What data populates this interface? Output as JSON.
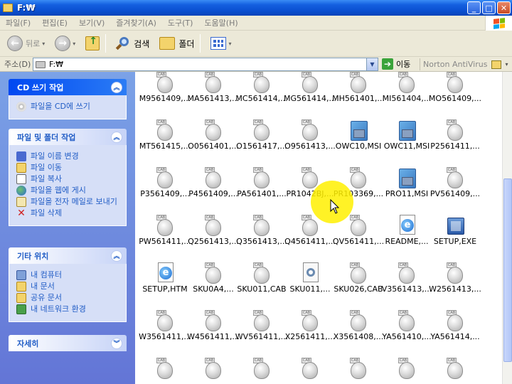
{
  "window": {
    "title": "F:₩",
    "min_glyph": "_",
    "max_glyph": "□",
    "close_glyph": "✕"
  },
  "menu": [
    "파일(F)",
    "편집(E)",
    "보기(V)",
    "즐겨찾기(A)",
    "도구(T)",
    "도움말(H)"
  ],
  "toolbar": {
    "back_label": "뒤로",
    "back_glyph": "←",
    "forward_glyph": "→",
    "dropdown_glyph": "▾",
    "search_label": "검색",
    "folders_label": "폴더"
  },
  "address": {
    "label": "주소(D)",
    "value": "F:₩",
    "go_label": "이동",
    "go_glyph": "➔",
    "dropdown_glyph": "▼",
    "norton_label": "Norton AntiVirus"
  },
  "taskpane": {
    "cd_tasks": {
      "title": "CD 쓰기 작업",
      "collapse_glyph": "︽",
      "items": [
        {
          "label": "파일을 CD에 쓰기",
          "icon": "cd-icon"
        }
      ]
    },
    "file_tasks": {
      "title": "파일 및 폴더 작업",
      "collapse_glyph": "︽",
      "items": [
        {
          "label": "파일 이름 변경",
          "icon": "rename-icon"
        },
        {
          "label": "파일 이동",
          "icon": "move-icon"
        },
        {
          "label": "파일 복사",
          "icon": "copy-icon"
        },
        {
          "label": "파일을 웹에 게시",
          "icon": "web-publish-icon"
        },
        {
          "label": "파일을 전자 메일로 보내기",
          "icon": "email-icon"
        },
        {
          "label": "파일 삭제",
          "icon": "delete-icon",
          "glyph": "✕"
        }
      ]
    },
    "other_places": {
      "title": "기타 위치",
      "collapse_glyph": "︽",
      "items": [
        {
          "label": "내 컴퓨터",
          "icon": "my-computer-icon"
        },
        {
          "label": "내 문서",
          "icon": "my-documents-icon"
        },
        {
          "label": "공유 문서",
          "icon": "shared-documents-icon"
        },
        {
          "label": "내 네트워크 환경",
          "icon": "network-places-icon"
        }
      ]
    },
    "details": {
      "title": "자세히",
      "expand_glyph": "︾"
    }
  },
  "cab_tag": "CAB",
  "ie_glyph": "e",
  "files": [
    {
      "name": "M9561409,...",
      "type": "cab"
    },
    {
      "name": "MA561413,...",
      "type": "cab"
    },
    {
      "name": "MC561414,...",
      "type": "cab"
    },
    {
      "name": "MG561414,...",
      "type": "cab"
    },
    {
      "name": "MH561401,...",
      "type": "cab"
    },
    {
      "name": "MI561404,...",
      "type": "cab"
    },
    {
      "name": "MO561409,...",
      "type": "cab"
    },
    {
      "name": "MT561415,...",
      "type": "cab"
    },
    {
      "name": "O0561401,...",
      "type": "cab"
    },
    {
      "name": "O1561417,...",
      "type": "cab"
    },
    {
      "name": "O9561413,...",
      "type": "cab"
    },
    {
      "name": "OWC10,MSI",
      "type": "msi"
    },
    {
      "name": "OWC11,MSI",
      "type": "msi"
    },
    {
      "name": "P2561411,...",
      "type": "cab"
    },
    {
      "name": "P3561409,...",
      "type": "cab"
    },
    {
      "name": "P4561409,...",
      "type": "cab"
    },
    {
      "name": "PA561401,...",
      "type": "cab"
    },
    {
      "name": "PR1042BJ,...",
      "type": "cab"
    },
    {
      "name": "PR103369,...",
      "type": "cab"
    },
    {
      "name": "PRO11,MSI",
      "type": "msi"
    },
    {
      "name": "PV561409,...",
      "type": "cab"
    },
    {
      "name": "PW561411,...",
      "type": "cab"
    },
    {
      "name": "Q2561413,...",
      "type": "cab"
    },
    {
      "name": "Q3561413,...",
      "type": "cab"
    },
    {
      "name": "Q4561411,...",
      "type": "cab"
    },
    {
      "name": "QV561411,...",
      "type": "cab"
    },
    {
      "name": "README,...",
      "type": "ie"
    },
    {
      "name": "SETUP,EXE",
      "type": "exe"
    },
    {
      "name": "SETUP,HTM",
      "type": "ie"
    },
    {
      "name": "SKU0A4,...",
      "type": "cab"
    },
    {
      "name": "SKU011,CAB",
      "type": "cab"
    },
    {
      "name": "SKU011,...",
      "type": "inf"
    },
    {
      "name": "SKU026,CAB",
      "type": "cab"
    },
    {
      "name": "V3561413,...",
      "type": "cab"
    },
    {
      "name": "W2561413,...",
      "type": "cab"
    },
    {
      "name": "W3561411,...",
      "type": "cab"
    },
    {
      "name": "W4561411,...",
      "type": "cab"
    },
    {
      "name": "WV561411,...",
      "type": "cab"
    },
    {
      "name": "X2561411,...",
      "type": "cab"
    },
    {
      "name": "X3561408,...",
      "type": "cab"
    },
    {
      "name": "YA561410,...",
      "type": "cab"
    },
    {
      "name": "YA561414,...",
      "type": "cab"
    },
    {
      "name": "",
      "type": "cab"
    },
    {
      "name": "",
      "type": "cab"
    },
    {
      "name": "",
      "type": "cab"
    },
    {
      "name": "",
      "type": "cab"
    },
    {
      "name": "",
      "type": "cab"
    },
    {
      "name": "",
      "type": "cab"
    },
    {
      "name": "",
      "type": "cab"
    }
  ]
}
